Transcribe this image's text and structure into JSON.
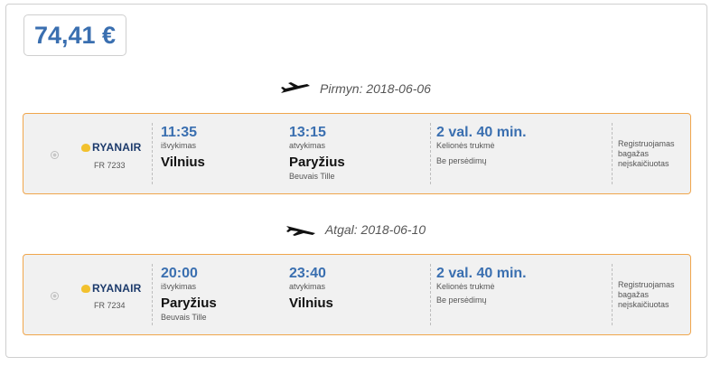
{
  "price": "74,41 €",
  "outbound": {
    "header": "Pirmyn: 2018-06-06",
    "airline": "RYANAIR",
    "flight_no": "FR 7233",
    "dep_time": "11:35",
    "dep_label": "išvykimas",
    "dep_city": "Vilnius",
    "dep_airport": "",
    "arr_time": "13:15",
    "arr_label": "atvykimas",
    "arr_city": "Paryžius",
    "arr_airport": "Beuvais Tille",
    "duration": "2 val. 40 min.",
    "duration_label": "Kelionės trukmė",
    "stops": "Be persėdimų",
    "baggage": "Registruojamas bagažas neįskaičiuotas"
  },
  "inbound": {
    "header": "Atgal: 2018-06-10",
    "airline": "RYANAIR",
    "flight_no": "FR 7234",
    "dep_time": "20:00",
    "dep_label": "išvykimas",
    "dep_city": "Paryžius",
    "dep_airport": "Beuvais Tille",
    "arr_time": "23:40",
    "arr_label": "atvykimas",
    "arr_city": "Vilnius",
    "arr_airport": "",
    "duration": "2 val. 40 min.",
    "duration_label": "Kelionės trukmė",
    "stops": "Be persėdimų",
    "baggage": "Registruojamas bagažas neįskaičiuotas"
  }
}
